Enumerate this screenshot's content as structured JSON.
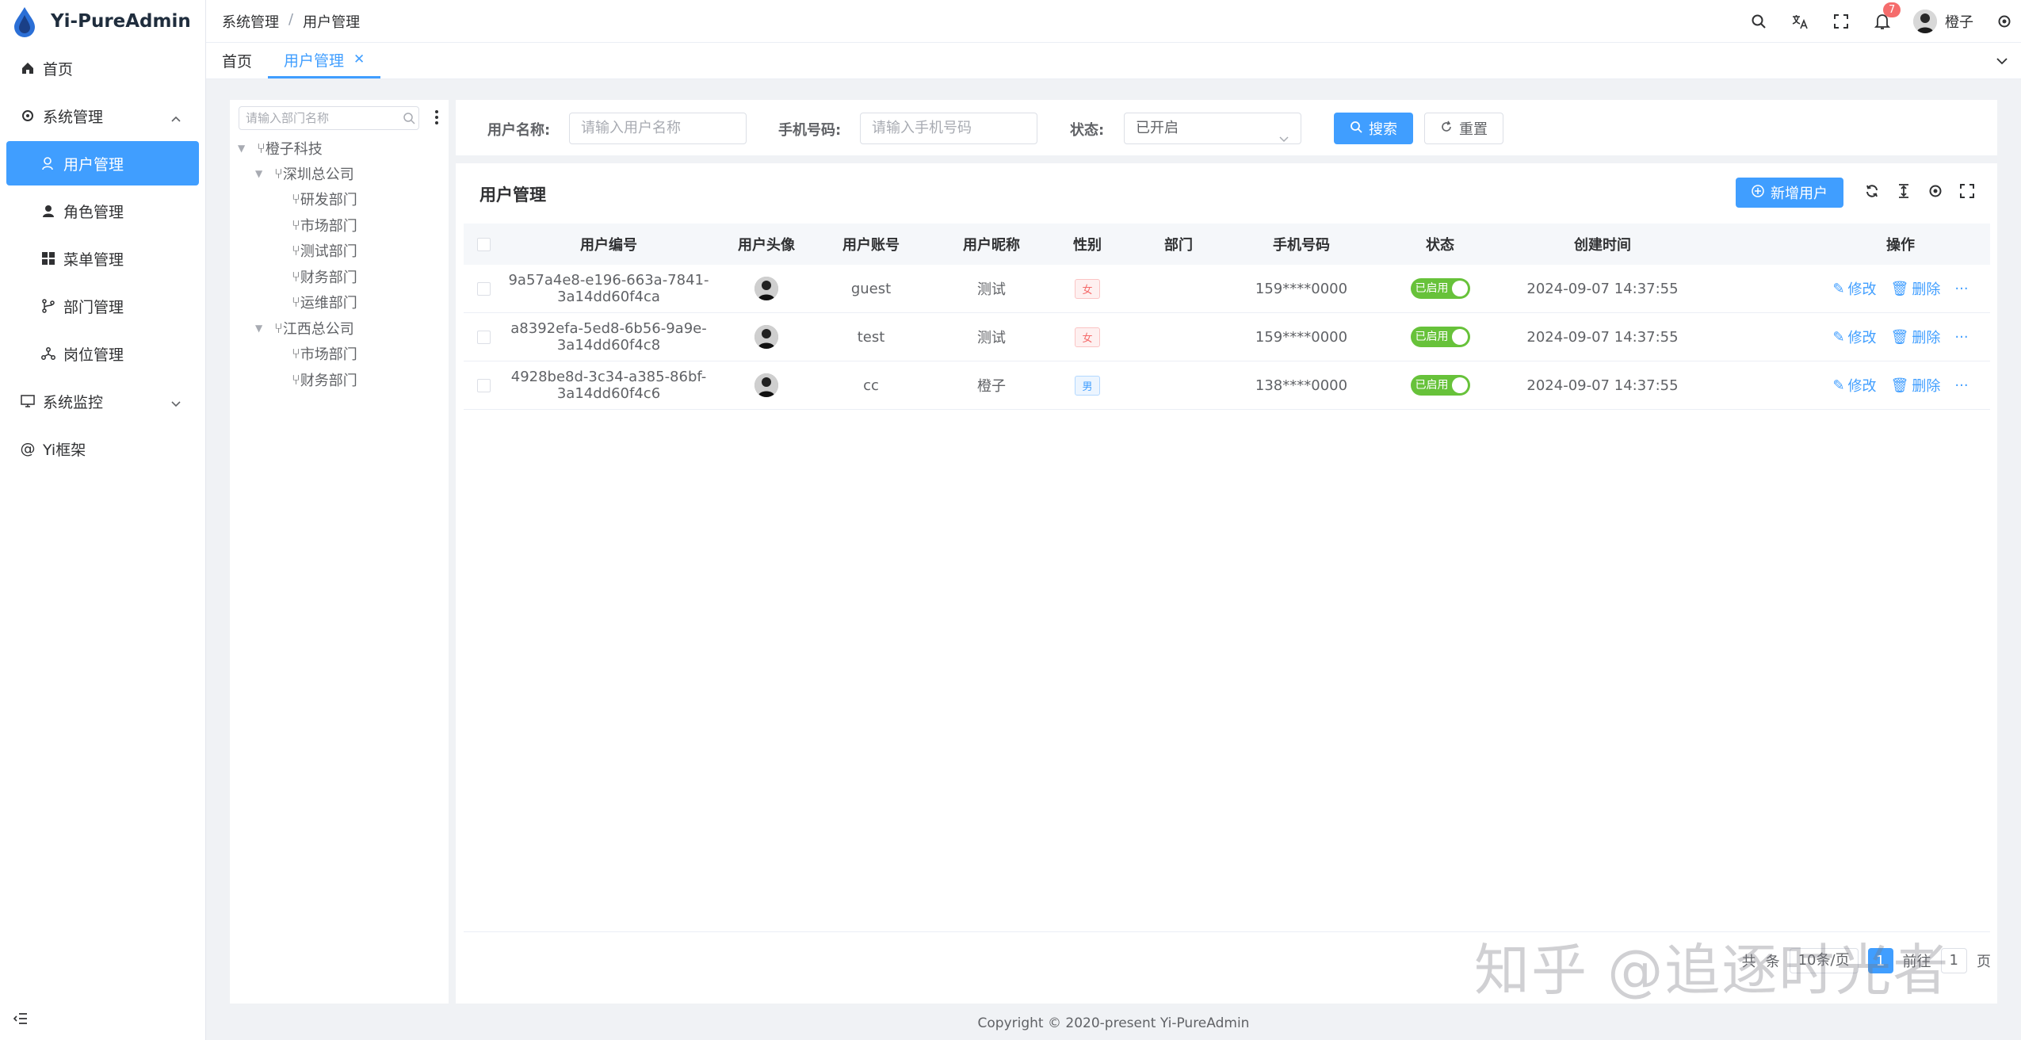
{
  "app": {
    "title": "Yi-PureAdmin",
    "brand_color": "#409eff"
  },
  "sidebar": {
    "items": [
      {
        "label": "首页",
        "icon": "home-icon"
      },
      {
        "label": "系统管理",
        "icon": "gear-icon",
        "expanded": true
      },
      {
        "label": "用户管理",
        "icon": "user-icon",
        "active": true
      },
      {
        "label": "角色管理",
        "icon": "role-icon"
      },
      {
        "label": "菜单管理",
        "icon": "grid-icon"
      },
      {
        "label": "部门管理",
        "icon": "branch-icon"
      },
      {
        "label": "岗位管理",
        "icon": "network-icon"
      },
      {
        "label": "系统监控",
        "icon": "monitor-icon"
      },
      {
        "label": "Yi框架",
        "icon": "at-icon"
      }
    ]
  },
  "header": {
    "breadcrumb": [
      "系统管理",
      "用户管理"
    ],
    "notification_count": "7",
    "username": "橙子"
  },
  "tags": [
    {
      "label": "首页"
    },
    {
      "label": "用户管理",
      "active": true
    }
  ],
  "dept_tree": {
    "search_placeholder": "请输入部门名称",
    "nodes": [
      {
        "label": "橙子科技",
        "level": 0,
        "expanded": true
      },
      {
        "label": "深圳总公司",
        "level": 1,
        "expanded": true
      },
      {
        "label": "研发部门",
        "level": 2
      },
      {
        "label": "市场部门",
        "level": 2
      },
      {
        "label": "测试部门",
        "level": 2
      },
      {
        "label": "财务部门",
        "level": 2
      },
      {
        "label": "运维部门",
        "level": 2
      },
      {
        "label": "江西总公司",
        "level": 1,
        "expanded": true
      },
      {
        "label": "市场部门",
        "level": 2
      },
      {
        "label": "财务部门",
        "level": 2
      }
    ]
  },
  "search_form": {
    "username_label": "用户名称:",
    "username_placeholder": "请输入用户名称",
    "phone_label": "手机号码:",
    "phone_placeholder": "请输入手机号码",
    "status_label": "状态:",
    "status_value": "已开启",
    "search_button": "搜索",
    "reset_button": "重置"
  },
  "table": {
    "title": "用户管理",
    "add_button": "新增用户",
    "columns": [
      "用户编号",
      "用户头像",
      "用户账号",
      "用户昵称",
      "性别",
      "部门",
      "手机号码",
      "状态",
      "创建时间",
      "操作"
    ],
    "rows": [
      {
        "id": "9a57a4e8-e196-663a-7841-3a14dd60f4ca",
        "account": "guest",
        "nickname": "测试",
        "gender": "女",
        "dept": "",
        "phone": "159****0000",
        "status": "已启用",
        "created": "2024-09-07 14:37:55"
      },
      {
        "id": "a8392efa-5ed8-6b56-9a9e-3a14dd60f4c8",
        "account": "test",
        "nickname": "测试",
        "gender": "女",
        "dept": "",
        "phone": "159****0000",
        "status": "已启用",
        "created": "2024-09-07 14:37:55"
      },
      {
        "id": "4928be8d-3c34-a385-86bf-3a14dd60f4c6",
        "account": "cc",
        "nickname": "橙子",
        "gender": "男",
        "dept": "",
        "phone": "138****0000",
        "status": "已启用",
        "created": "2024-09-07 14:37:55"
      }
    ],
    "edit_label": "修改",
    "delete_label": "删除",
    "more_label": "···"
  },
  "pagination": {
    "total_prefix": "共",
    "total_suffix": "条",
    "page_size": "10条/页",
    "current_page": "1",
    "goto_prefix": "前往",
    "goto_value": "1",
    "goto_suffix": "页"
  },
  "watermark": "知乎 @追逐时光者",
  "footer": "Copyright © 2020-present Yi-PureAdmin"
}
